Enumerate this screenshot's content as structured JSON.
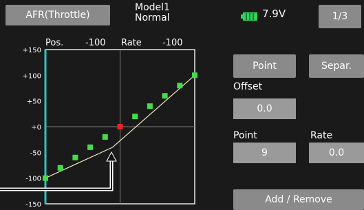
{
  "header": {
    "function_name": "AFR(Throttle)",
    "model_name": "Model1",
    "condition": "Normal",
    "battery_voltage": "7.9V",
    "page_indicator": "1/3"
  },
  "graph": {
    "pos_label": "Pos.",
    "pos_rate": "-100",
    "rate_label": "Rate",
    "rate_value": "-100",
    "y_ticks": [
      "+150",
      "+100",
      "+50",
      "+0",
      "-50",
      "-100",
      "-150"
    ],
    "y_range": [
      -150,
      150
    ],
    "x_range": [
      -100,
      100
    ],
    "curve_points": [
      [
        -100,
        -100
      ],
      [
        -80,
        -80
      ],
      [
        -60,
        -60
      ],
      [
        -40,
        -40
      ],
      [
        -20,
        -20
      ],
      [
        0,
        0
      ],
      [
        20,
        20
      ],
      [
        40,
        40
      ],
      [
        60,
        60
      ],
      [
        80,
        80
      ],
      [
        100,
        100
      ]
    ],
    "output_line": [
      [
        -100,
        -100
      ],
      [
        -10,
        -40
      ],
      [
        100,
        100
      ]
    ],
    "selected_point_index": 5,
    "cursor_x": 0
  },
  "buttons": {
    "point": "Point",
    "separ": "Separ.",
    "add_remove": "Add / Remove"
  },
  "offset": {
    "label": "Offset",
    "value": "0.0"
  },
  "point_field": {
    "label": "Point",
    "value": "9"
  },
  "rate_field": {
    "label": "Rate",
    "value": "0.0"
  },
  "colors": {
    "curve_point": "#44dd44",
    "selected_point": "#ee2222",
    "output_line": "#e8e8c0",
    "axis_left": "#30c0c0"
  }
}
